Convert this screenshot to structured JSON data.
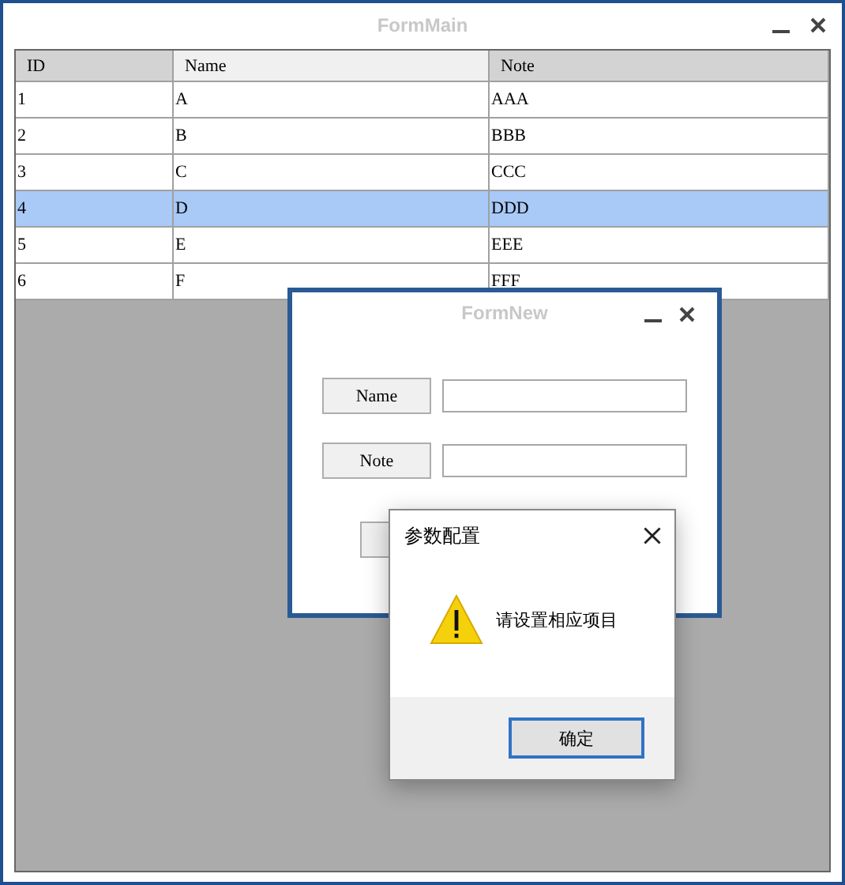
{
  "main_window": {
    "title": "FormMain"
  },
  "table": {
    "columns": [
      "ID",
      "Name",
      "Note"
    ],
    "rows": [
      {
        "cells": [
          "1",
          "A",
          "AAA"
        ],
        "selected": false
      },
      {
        "cells": [
          "2",
          "B",
          "BBB"
        ],
        "selected": false
      },
      {
        "cells": [
          "3",
          "C",
          "CCC"
        ],
        "selected": false
      },
      {
        "cells": [
          "4",
          "D",
          "DDD"
        ],
        "selected": true
      },
      {
        "cells": [
          "5",
          "E",
          "EEE"
        ],
        "selected": false
      },
      {
        "cells": [
          "6",
          "F",
          "FFF"
        ],
        "selected": false
      }
    ]
  },
  "form_new": {
    "title": "FormNew",
    "fields": [
      {
        "label": "Name"
      },
      {
        "label": "Note"
      }
    ]
  },
  "dialog": {
    "title": "参数配置",
    "message": "请设置相应项目",
    "button": "确定"
  }
}
